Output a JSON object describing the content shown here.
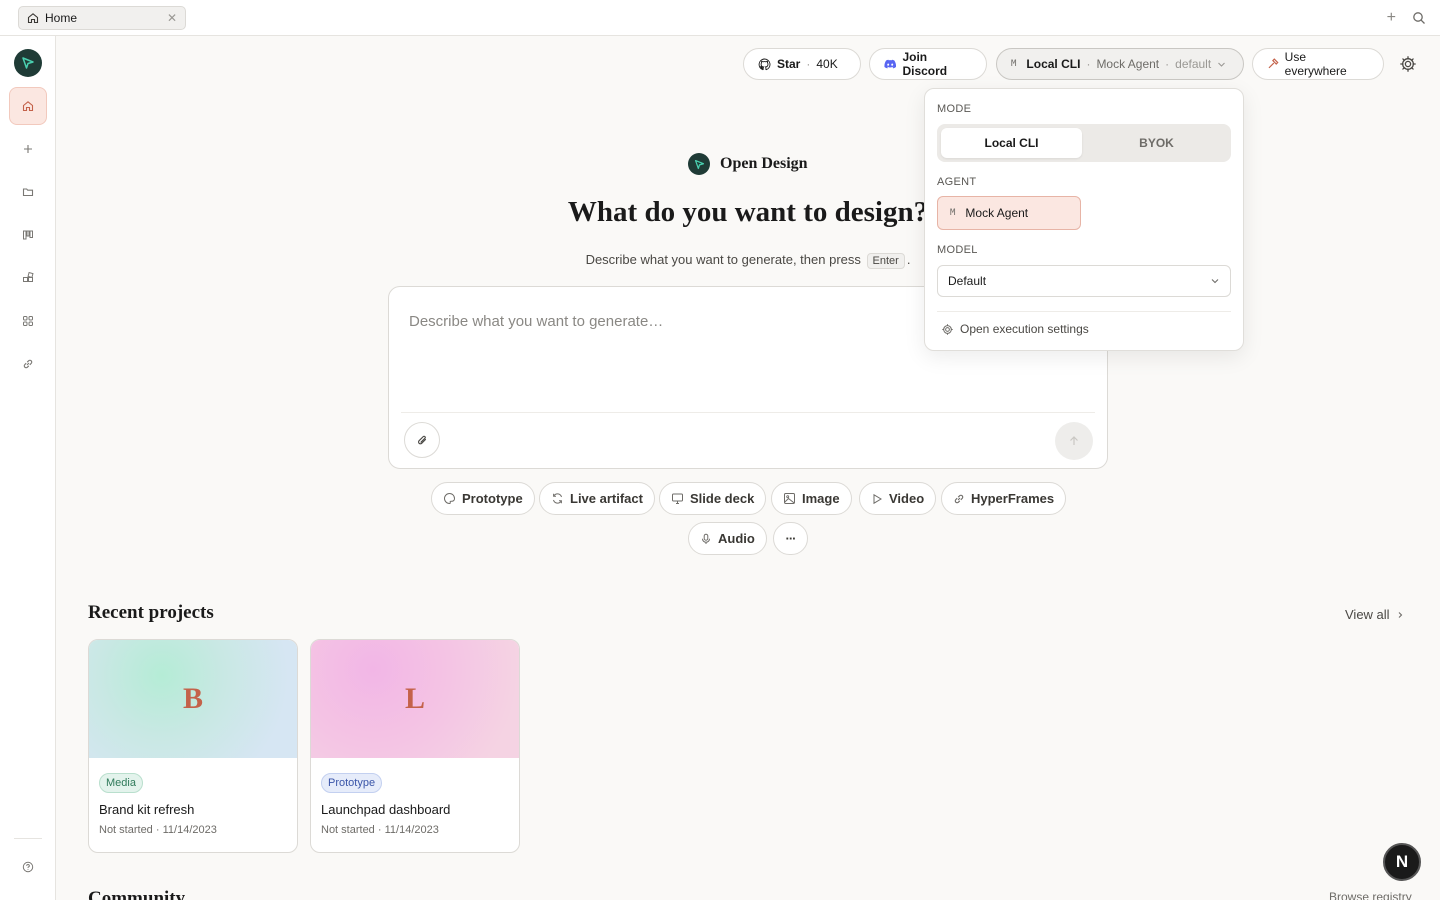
{
  "tabbar": {
    "tab_label": "Home",
    "close": "✕",
    "add": "+"
  },
  "header": {
    "star_label": "Star",
    "star_sep": "·",
    "star_count": "40K",
    "discord_label": "Join Discord",
    "agent_mode": "Local CLI",
    "agent_sep1": "·",
    "agent_name": "Mock Agent",
    "agent_sep2": "·",
    "agent_model": "default",
    "agent_badge": "M",
    "use_everywhere": "Use everywhere"
  },
  "hero": {
    "brand": "Open Design",
    "headline": "What do you want to design?",
    "subline_before": "Describe what you want to generate, then press",
    "subline_key": "Enter",
    "subline_after": ".",
    "placeholder": "Describe what you want to generate…"
  },
  "chips": [
    "Prototype",
    "Live artifact",
    "Slide deck",
    "Image",
    "Video",
    "HyperFrames",
    "Audio"
  ],
  "more": "···",
  "recent": {
    "title": "Recent projects",
    "view_all": "View all",
    "projects": [
      {
        "letter": "B",
        "badge": "Media",
        "name": "Brand kit refresh",
        "status": "Not started",
        "sep": "·",
        "date": "11/14/2023",
        "badge_bg": "#e3f3ec",
        "badge_fg": "#2f7a5a",
        "badge_border": "#b9dfcd"
      },
      {
        "letter": "L",
        "badge": "Prototype",
        "name": "Launchpad dashboard",
        "status": "Not started",
        "sep": "·",
        "date": "11/14/2023",
        "badge_bg": "#e6ecfa",
        "badge_fg": "#3a55a8",
        "badge_border": "#c3d0f0"
      }
    ]
  },
  "community": {
    "title": "Community",
    "browse": "Browse registry"
  },
  "popover": {
    "mode_label": "MODE",
    "mode_options": [
      "Local CLI",
      "BYOK"
    ],
    "mode_selected": "Local CLI",
    "agent_label": "AGENT",
    "agent_badge": "M",
    "agent_value": "Mock Agent",
    "model_label": "MODEL",
    "model_value": "Default",
    "exec_link": "Open execution settings"
  },
  "fab_label": "N",
  "colors": {
    "accent": "#c4624a",
    "accent_bg": "#fbe7e1",
    "logo_bg": "#1f3b36",
    "logo_mark": "#4ad0b0"
  }
}
